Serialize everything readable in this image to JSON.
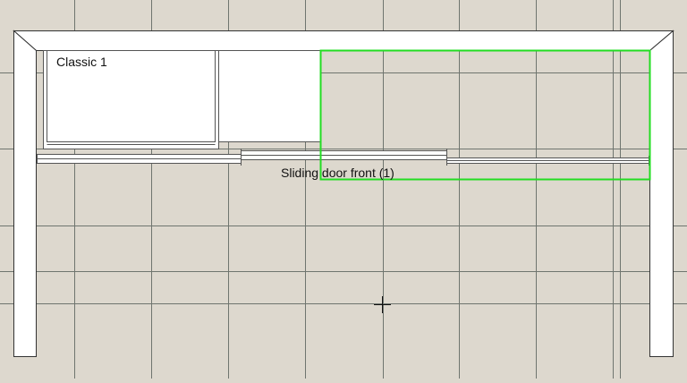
{
  "plan": {
    "cabinet_label": "Classic 1",
    "front_label": "Sliding door front (1)"
  },
  "colors": {
    "background": "#ddd8ce",
    "grid_line": "#6f756f",
    "outline": "#333333",
    "panel_fill": "#ffffff",
    "selection": "#22dd22"
  },
  "icons": {
    "cursor": "crosshair-icon"
  }
}
